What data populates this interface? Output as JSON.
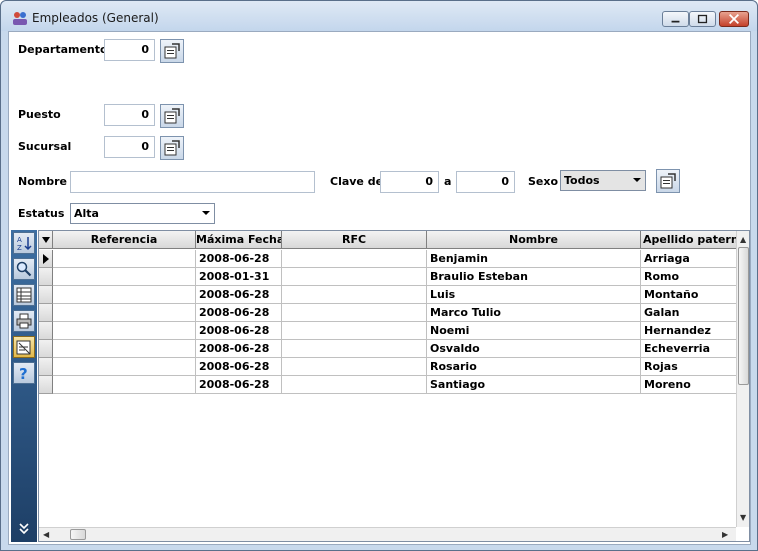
{
  "window": {
    "title": "Empleados (General)"
  },
  "filters": {
    "departamento": {
      "label": "Departamento",
      "value": "0"
    },
    "puesto": {
      "label": "Puesto",
      "value": "0"
    },
    "sucursal": {
      "label": "Sucursal",
      "value": "0"
    },
    "nombre": {
      "label": "Nombre",
      "value": ""
    },
    "clave": {
      "label": "Clave de",
      "from": "0",
      "to_label": "a",
      "to": "0"
    },
    "sexo": {
      "label": "Sexo",
      "selected": "Todos"
    },
    "estatus": {
      "label": "Estatus",
      "selected": "Alta"
    }
  },
  "toolbar": {
    "icons": [
      "sort-az-icon",
      "search-icon",
      "table-icon",
      "print-icon",
      "edit-icon",
      "help-icon",
      "expand-icon"
    ]
  },
  "grid": {
    "columns": [
      "Referencia",
      "Máxima Fecha",
      "RFC",
      "Nombre",
      "Apellido paterno"
    ],
    "rows": [
      {
        "referencia": "",
        "fecha": "2008-06-28",
        "rfc": "",
        "nombre": "Benjamin",
        "apellido": "Arriaga"
      },
      {
        "referencia": "",
        "fecha": "2008-01-31",
        "rfc": "",
        "nombre": "Braulio Esteban",
        "apellido": "Romo"
      },
      {
        "referencia": "",
        "fecha": "2008-06-28",
        "rfc": "",
        "nombre": "Luis",
        "apellido": "Montaño"
      },
      {
        "referencia": "",
        "fecha": "2008-06-28",
        "rfc": "",
        "nombre": "Marco Tulio",
        "apellido": "Galan"
      },
      {
        "referencia": "",
        "fecha": "2008-06-28",
        "rfc": "",
        "nombre": "Noemi",
        "apellido": "Hernandez"
      },
      {
        "referencia": "",
        "fecha": "2008-06-28",
        "rfc": "",
        "nombre": "Osvaldo",
        "apellido": "Echeverria"
      },
      {
        "referencia": "",
        "fecha": "2008-06-28",
        "rfc": "",
        "nombre": "Rosario",
        "apellido": "Rojas"
      },
      {
        "referencia": "",
        "fecha": "2008-06-28",
        "rfc": "",
        "nombre": "Santiago",
        "apellido": "Moreno"
      }
    ]
  }
}
